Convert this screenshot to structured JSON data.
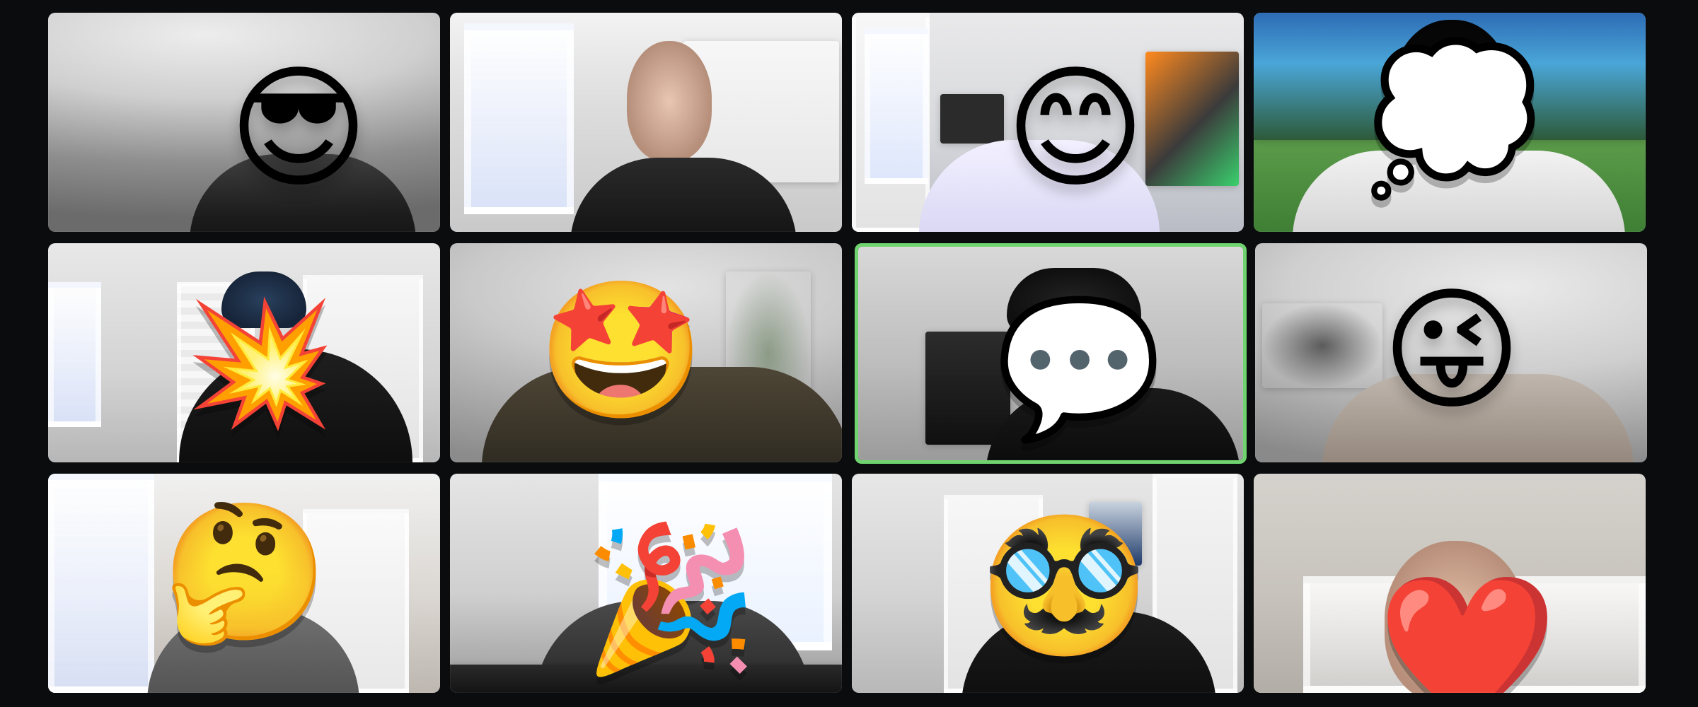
{
  "tiles": [
    {
      "emoji": "😎",
      "emoji_icon": "sunglasses-face-emoji-icon"
    },
    {
      "emoji": "",
      "emoji_icon": ""
    },
    {
      "emoji": "😊",
      "emoji_icon": "smiling-face-emoji-icon"
    },
    {
      "emoji": "💭",
      "emoji_icon": "thought-bubble-emoji-icon"
    },
    {
      "emoji": "💥",
      "emoji_icon": "collision-emoji-icon"
    },
    {
      "emoji": "🤩",
      "emoji_icon": "star-struck-emoji-icon"
    },
    {
      "emoji": "💬",
      "emoji_icon": "speech-bubble-emoji-icon"
    },
    {
      "emoji": "😜",
      "emoji_icon": "winking-face-with-tongue-emoji-icon"
    },
    {
      "emoji": "🤔",
      "emoji_icon": "thinking-face-emoji-icon"
    },
    {
      "emoji": "🎉",
      "emoji_icon": "party-popper-emoji-icon"
    },
    {
      "emoji": "🥸",
      "emoji_icon": "disguised-face-emoji-icon"
    },
    {
      "emoji": "❤️",
      "emoji_icon": "red-heart-emoji-icon"
    }
  ],
  "active_speaker_index": 6,
  "colors": {
    "background": "#0b0c0e",
    "active_border": "#6fd36f"
  }
}
